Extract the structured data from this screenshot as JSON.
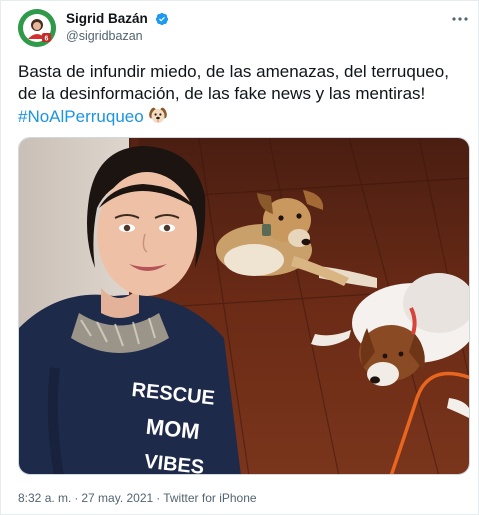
{
  "author": {
    "display_name": "Sigrid Bazán",
    "handle": "@sigridbazan",
    "verified": true,
    "avatar_badge": "6"
  },
  "tweet": {
    "text": "Basta de infundir miedo, de las amenazas, del terruqueo, de la desinformación, de las fake news y las mentiras! ",
    "hashtag": "#NoAlPerruqueo",
    "emoji": "dog-face-icon",
    "hoodie_text": [
      "RESCUE",
      "MOM",
      "VIBES"
    ]
  },
  "meta": {
    "time": "8:32 a. m.",
    "separator": "·",
    "date": "27 may. 2021",
    "source": "Twitter for iPhone"
  },
  "colors": {
    "link": "#1b95e0",
    "verified": "#1d9bf0",
    "avatar_bg": "#2e9a4a",
    "muted": "#536471"
  }
}
